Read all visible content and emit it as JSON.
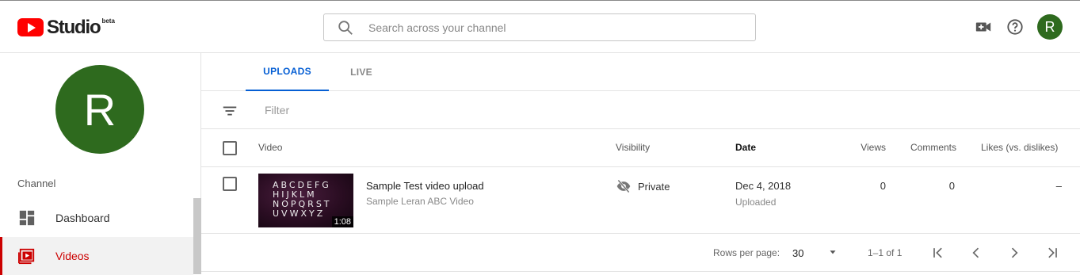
{
  "app": {
    "logo_text": "Studio",
    "logo_badge": "beta"
  },
  "search": {
    "placeholder": "Search across your channel"
  },
  "header": {
    "avatar_initial": "R",
    "icons": [
      "create-video-icon",
      "help-icon"
    ]
  },
  "sidebar": {
    "avatar_initial": "R",
    "section_label": "Channel",
    "items": [
      {
        "label": "Dashboard",
        "icon": "dashboard-icon",
        "active": false
      },
      {
        "label": "Videos",
        "icon": "videos-icon",
        "active": true
      }
    ]
  },
  "tabs": [
    {
      "label": "UPLOADS",
      "active": true
    },
    {
      "label": "LIVE",
      "active": false
    }
  ],
  "filter": {
    "placeholder": "Filter"
  },
  "table": {
    "columns": {
      "video": "Video",
      "visibility": "Visibility",
      "date": "Date",
      "views": "Views",
      "comments": "Comments",
      "likes": "Likes (vs. dislikes)"
    },
    "rows": [
      {
        "title": "Sample Test video upload",
        "description": "Sample Leran ABC Video",
        "duration": "1:08",
        "thumbnail_text": "ABCDEFG\nHIJKLM\nNOPQRST\nUVWXYZ",
        "visibility": "Private",
        "date": "Dec 4, 2018",
        "date_status": "Uploaded",
        "views": "0",
        "comments": "0",
        "likes": "–"
      }
    ]
  },
  "pagination": {
    "rows_per_page_label": "Rows per page:",
    "rows_per_page": "30",
    "range": "1–1 of 1"
  },
  "colors": {
    "accent_blue": "#065fd4",
    "brand_red": "#ff0000",
    "active_red": "#cc0000",
    "avatar_green": "#2e6a1e"
  }
}
